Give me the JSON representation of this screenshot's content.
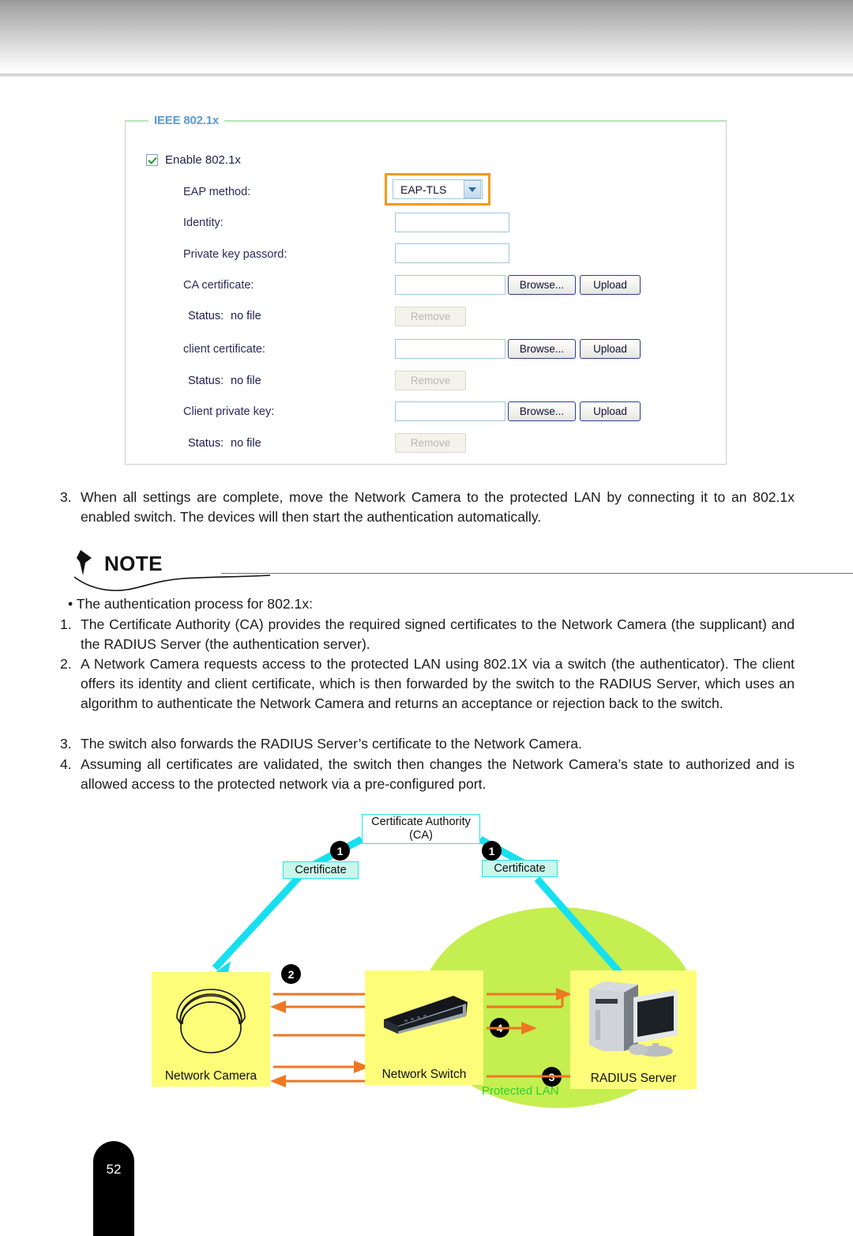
{
  "page": {
    "number": "52"
  },
  "settings_panel": {
    "legend": "IEEE 802.1x",
    "enable_checkbox_label": "Enable 802.1x",
    "fields": {
      "eap_method_label": "EAP method:",
      "eap_method_value": "EAP-TLS",
      "identity_label": "Identity:",
      "identity_value": "",
      "private_key_password_label": "Private key passord:",
      "private_key_password_value": "",
      "ca_certificate_label": "CA certificate:",
      "ca_certificate_value": "",
      "ca_status_label": "Status:",
      "ca_status_value": "no file",
      "client_certificate_label": "client certificate:",
      "client_certificate_value": "",
      "client_status_label": "Status:",
      "client_status_value": "no file",
      "client_private_key_label": "Client private key:",
      "client_private_key_value": "",
      "key_status_label": "Status:",
      "key_status_value": "no file"
    },
    "buttons": {
      "browse": "Browse...",
      "upload": "Upload",
      "remove": "Remove"
    },
    "colors": {
      "legend_text": "#5b9bd5",
      "panel_top_border": "#b9e4b6",
      "highlight": "#f59a12",
      "check": "#17a01b"
    }
  },
  "body": {
    "step3": {
      "number": "3.",
      "text": "When all settings are complete, move the Network Camera to the protected LAN by connecting it to an 802.1x enabled switch. The devices will then start the authentication automatically."
    }
  },
  "note": {
    "heading": "NOTE",
    "bullet": "• The authentication process for 802.1x:",
    "items": [
      {
        "number": "1.",
        "text": "The Certificate Authority (CA) provides the required signed certificates to the Network Camera (the supplicant) and the RADIUS Server (the authentication server)."
      },
      {
        "number": "2.",
        "text": "A Network Camera requests access to the protected LAN using 802.1X via a switch (the authenticator).  The client offers its identity and client certificate, which is then forwarded by the switch to the RADIUS Server, which uses an algorithm to authenticate the Network Camera and returns an acceptance or rejection back to the switch."
      },
      {
        "number": "3.",
        "text": "The switch also forwards the RADIUS Server’s certificate to the Network Camera."
      },
      {
        "number": "4.",
        "text": "Assuming all certificates are validated, the switch then changes the Network Camera’s state to authorized and is allowed access to the protected network via a pre-configured port."
      }
    ]
  },
  "diagram": {
    "ca_title_line1": "Certificate Authority",
    "ca_title_line2": "(CA)",
    "certificate_left": "Certificate",
    "certificate_right": "Certificate",
    "badge_left": "1",
    "badge_right": "1",
    "badge_camera": "2",
    "badge_radius_low": "3",
    "badge_switch": "4",
    "node_camera": "Network Camera",
    "node_switch": "Network Switch",
    "node_radius": "RADIUS Server",
    "protected_lan": "Protected LAN",
    "colors": {
      "lan_fill": "#c5ee50",
      "node_fill": "#fdfd7a",
      "arrow_cyan": "#16e0f0",
      "arrow_orange": "#ee7722",
      "lan_text": "#2fd12f"
    }
  }
}
